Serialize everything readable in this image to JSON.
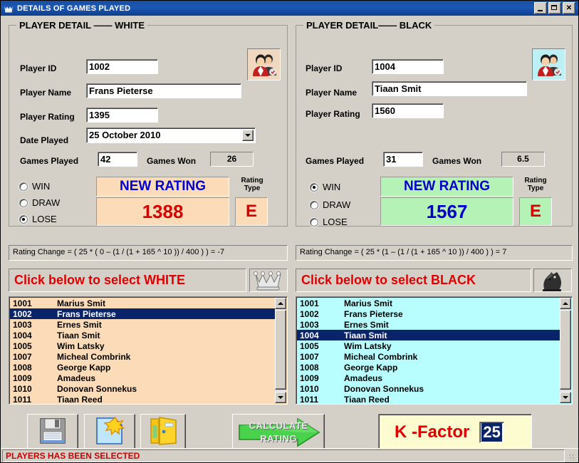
{
  "window": {
    "title": "DETAILS OF GAMES PLAYED",
    "icon": "chess-queen-icon",
    "minimize_label": "",
    "maximize_label": "",
    "close_label": "✕"
  },
  "colors": {
    "title_bar": "#1b57b3",
    "face": "#d4d0c8",
    "white_panel": "#fcdcb8",
    "black_panel": "#b8feff",
    "selection": "#0a246a",
    "alert_red": "#e00000",
    "rating_blue": "#0000cc",
    "kfactor_bg": "#fcfcd0"
  },
  "white_panel": {
    "legend": "PLAYER DETAIL  ——  WHITE",
    "avatar_icon": "players-avatar-icon",
    "fields": [
      {
        "label": "Player ID",
        "value": "1002"
      },
      {
        "label": "Player Name",
        "value": "Frans Pieterse"
      },
      {
        "label": "Player Rating",
        "value": "1395"
      }
    ],
    "date_played": {
      "label": "Date Played",
      "value": "25   October   2010"
    },
    "games_played": {
      "label": "Games Played",
      "value": "42"
    },
    "games_won": {
      "label": "Games Won",
      "value": "26"
    },
    "result_options": [
      {
        "label": "WIN",
        "checked": false
      },
      {
        "label": "DRAW",
        "checked": false
      },
      {
        "label": "LOSE",
        "checked": true
      }
    ],
    "new_rating_caption": "NEW RATING",
    "new_rating_value": "1388",
    "rating_type_caption_line1": "Rating",
    "rating_type_caption_line2": "Type",
    "rating_type_value": "E",
    "formula": "Rating Change = ( 25 *  ( 0 –  (1 / (1 + 165 ^ 10 ))  / 400  ) ) = -7",
    "select_banner": "Click below to select WHITE",
    "piece_icon": "chess-queen-piece-icon"
  },
  "black_panel": {
    "legend": "PLAYER DETAIL——  BLACK",
    "avatar_icon": "players-avatar-icon",
    "fields": [
      {
        "label": "Player ID",
        "value": "1004"
      },
      {
        "label": "Player Name",
        "value": "Tiaan Smit"
      },
      {
        "label": "Player Rating",
        "value": "1560"
      }
    ],
    "games_played": {
      "label": "Games Played",
      "value": "31"
    },
    "games_won": {
      "label": "Games Won",
      "value": "6.5"
    },
    "result_options": [
      {
        "label": "WIN",
        "checked": true
      },
      {
        "label": "DRAW",
        "checked": false
      },
      {
        "label": "LOSE",
        "checked": false
      }
    ],
    "new_rating_caption": "NEW RATING",
    "new_rating_value": "1567",
    "rating_type_caption_line1": "Rating",
    "rating_type_caption_line2": "Type",
    "rating_type_value": "E",
    "formula": "Rating Change = ( 25 *  (1 –  (1 / (1 + 165 ^ 10 ))  / 400  ) ) = 7",
    "select_banner": "Click below to select BLACK",
    "piece_icon": "chess-knight-piece-icon"
  },
  "players": [
    {
      "id": "1001",
      "name": "Marius Smit"
    },
    {
      "id": "1002",
      "name": "Frans Pieterse"
    },
    {
      "id": "1003",
      "name": "Ernes Smit"
    },
    {
      "id": "1004",
      "name": "Tiaan Smit"
    },
    {
      "id": "1005",
      "name": "Wim Latsky"
    },
    {
      "id": "1007",
      "name": "Micheal Combrink"
    },
    {
      "id": "1008",
      "name": "George Kapp"
    },
    {
      "id": "1009",
      "name": "Amadeus"
    },
    {
      "id": "1010",
      "name": "Donovan Sonnekus"
    },
    {
      "id": "1011",
      "name": "Tiaan Reed"
    }
  ],
  "white_list_selected_id": "1002",
  "black_list_selected_id": "1004",
  "toolbar": {
    "save_button": {
      "name": "save-button",
      "icon": "floppy-disk-icon"
    },
    "new_button": {
      "name": "new-button",
      "icon": "new-document-star-icon"
    },
    "exit_button": {
      "name": "exit-button",
      "icon": "open-door-icon"
    },
    "calculate_button": {
      "icon": "green-arrow-icon",
      "line1": "CALCULATE",
      "line2": "RATING"
    },
    "kfactor": {
      "label": "K -Factor",
      "value": "25"
    }
  },
  "statusbar": {
    "message": "PLAYERS HAS BEEN SELECTED"
  }
}
